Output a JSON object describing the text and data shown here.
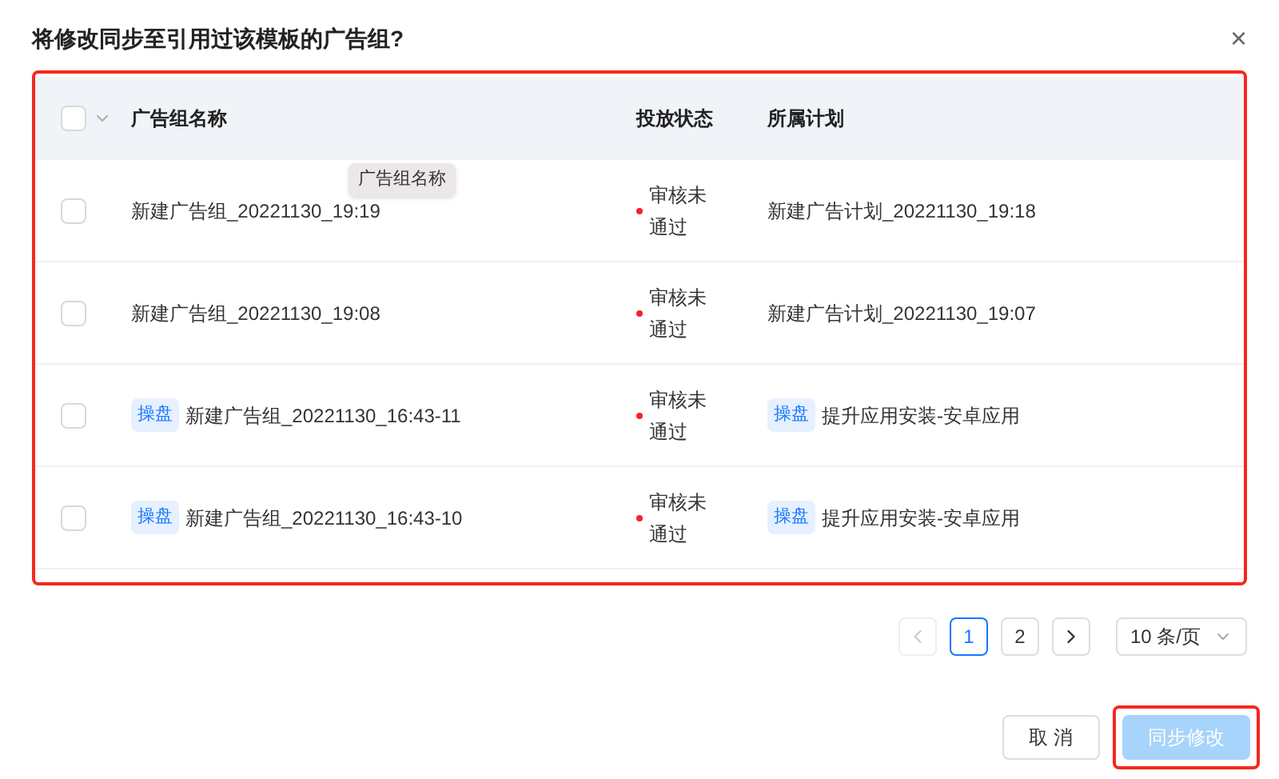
{
  "dialog": {
    "title": "将修改同步至引用过该模板的广告组?",
    "close": "×"
  },
  "table": {
    "select_all": {
      "checked": false
    },
    "columns": [
      "广告组名称",
      "投放状态",
      "所属计划"
    ],
    "tooltip": "广告组名称",
    "rows": [
      {
        "checked": false,
        "name_tag": null,
        "name": "新建广告组_20221130_19:19",
        "status": "审核未通过",
        "color": "#f5222d",
        "plan_tag": null,
        "plan": "新建广告计划_20221130_19:18"
      },
      {
        "checked": false,
        "name_tag": null,
        "name": "新建广告组_20221130_19:08",
        "status": "审核未通过",
        "color": "#f5222d",
        "plan_tag": null,
        "plan": "新建广告计划_20221130_19:07"
      },
      {
        "checked": false,
        "name_tag": "操盘",
        "name": "新建广告组_20221130_16:43-11",
        "status": "审核未通过",
        "color": "#f5222d",
        "plan_tag": "操盘",
        "plan": "提升应用安装-安卓应用"
      },
      {
        "checked": false,
        "name_tag": "操盘",
        "name": "新建广告组_20221130_16:43-10",
        "status": "审核未通过",
        "color": "#f5222d",
        "plan_tag": "操盘",
        "plan": "提升应用安装-安卓应用"
      }
    ]
  },
  "pagination": {
    "prev_disabled": true,
    "next_disabled": false,
    "pages": [
      {
        "label": "1",
        "selected": true
      },
      {
        "label": "2",
        "selected": false
      }
    ],
    "page_size": "10 条/页"
  },
  "buttons": [
    {
      "label": "取 消",
      "kind": "default",
      "disabled": false
    },
    {
      "label": "同步修改",
      "kind": "primary",
      "disabled": true
    }
  ]
}
